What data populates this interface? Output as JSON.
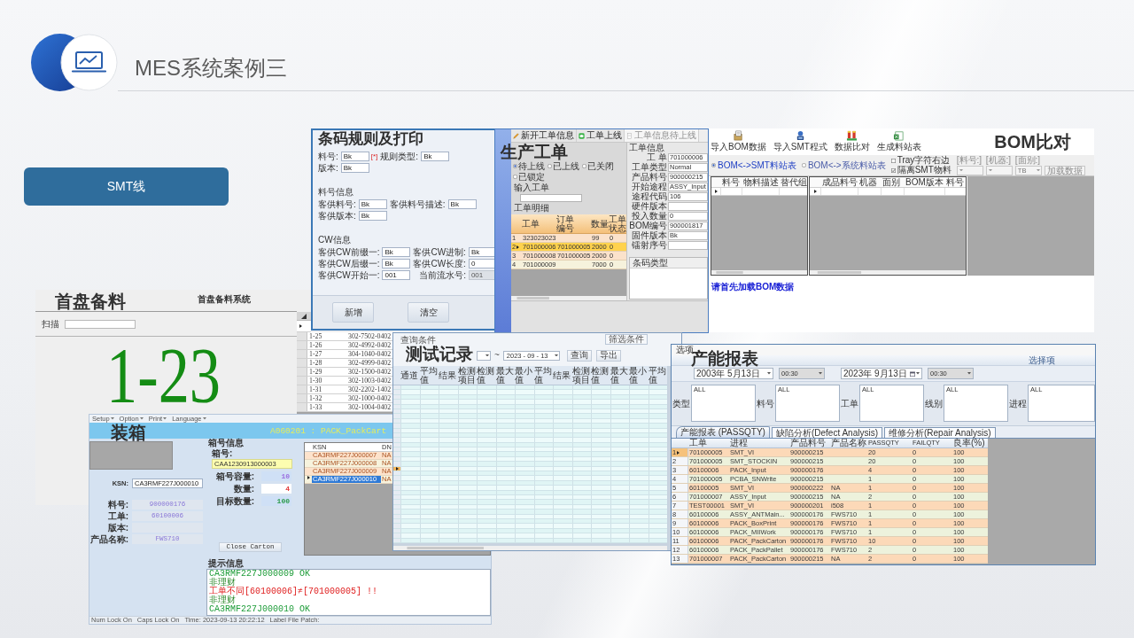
{
  "header": {
    "title": "MES系统案例三"
  },
  "line_button": {
    "label": "SMT线"
  },
  "screenshots": [
    {
      "kind": "first_reel",
      "title": "首盘备料",
      "subtitle": "首盘备料系统",
      "scan_label": "扫描",
      "current_slot": "1-23",
      "rows": [
        {
          "slot": "1-25",
          "part": "302-7502-0402"
        },
        {
          "slot": "1-26",
          "part": "302-4992-0402"
        },
        {
          "slot": "1-27",
          "part": "304-1040-0402"
        },
        {
          "slot": "1-28",
          "part": "302-4999-0402"
        },
        {
          "slot": "1-29",
          "part": "302-1500-0402"
        },
        {
          "slot": "1-30",
          "part": "302-1003-0402"
        },
        {
          "slot": "1-31",
          "part": "302-2202-1402"
        },
        {
          "slot": "1-32",
          "part": "302-1000-0402"
        },
        {
          "slot": "1-33",
          "part": "302-1004-0402"
        }
      ]
    },
    {
      "kind": "barcode_rules",
      "title": "条码规则及打印",
      "top_fields": [
        {
          "label": "料号:",
          "value": "Bk",
          "required_mark": "[*]",
          "disabled": false
        },
        {
          "label": "规则类型:",
          "value": "Bk",
          "disabled": false
        },
        {
          "label": "版本:",
          "value": "Bk",
          "disabled": false
        }
      ],
      "groups": [
        {
          "heading": "料号信息",
          "fields": [
            {
              "label": "客供料号:",
              "value": "Bk",
              "disabled": false
            },
            {
              "label": "客供料号描述:",
              "value": "Bk",
              "disabled": false
            },
            {
              "label": "客供版本:",
              "value": "Bk",
              "disabled": false
            }
          ]
        },
        {
          "heading": "CW信息",
          "fields": [
            {
              "label": "客供CW前缀一:",
              "value": "Bk",
              "disabled": false
            },
            {
              "label": "客供CW进制:",
              "value": "Bk",
              "disabled": false
            },
            {
              "label": "客供CW后缀一:",
              "value": "Bk",
              "disabled": false
            },
            {
              "label": "客供CW长度:",
              "value": "0",
              "disabled": false
            },
            {
              "label": "客供CW开始一:",
              "value": "001",
              "disabled": false
            },
            {
              "label": "当前流水号:",
              "value": "001",
              "disabled": true
            }
          ]
        }
      ],
      "buttons": [
        "新增",
        "清空"
      ]
    },
    {
      "kind": "work_order",
      "title": "生产工单",
      "toolbar": [
        {
          "label": "新开工单信息",
          "disabled": false
        },
        {
          "label": "工单上线",
          "disabled": false
        },
        {
          "label": "工单信息待上线",
          "disabled": true
        }
      ],
      "status_options": [
        {
          "label": "待上线",
          "selected": true
        },
        {
          "label": "已上线",
          "selected": false
        },
        {
          "label": "已关闭",
          "selected": false
        },
        {
          "label": "已锁定",
          "selected": false
        }
      ],
      "input_label": "输入工单",
      "table_label": "工单明细",
      "columns": [
        "工单",
        "订单编号",
        "数量",
        "工单状态"
      ],
      "rows": [
        {
          "index": "1",
          "cells": [
            "323023023",
            null,
            "99",
            "0"
          ],
          "selected": false
        },
        {
          "index": "2",
          "cells": [
            "701000006",
            "701000005",
            "2000",
            "0"
          ],
          "selected": true
        },
        {
          "index": "3",
          "cells": [
            "701000008",
            "701000005",
            "2000",
            "0"
          ],
          "selected": false
        },
        {
          "index": "4",
          "cells": [
            "701000009",
            null,
            "7000",
            "0"
          ],
          "selected": false
        }
      ],
      "info_heading": "工单信息",
      "info": [
        {
          "label": "工 单",
          "value": "701000006"
        },
        {
          "label": "工单类型",
          "value": "Normal"
        },
        {
          "label": "产品料号",
          "value": "900000215"
        },
        {
          "label": "开始途程",
          "value": "ASSY_Input"
        },
        {
          "label": "途程代码",
          "value": "106"
        },
        {
          "label": "硬件版本"
        },
        {
          "label": "投入数量",
          "value": "0"
        },
        {
          "label": "BOM编号",
          "value": "900001817"
        },
        {
          "label": "固件版本",
          "value": "Bk"
        },
        {
          "label": "镭射序号"
        }
      ],
      "barcode_columns": [
        "条码类型"
      ]
    },
    {
      "kind": "bom_compare",
      "title": "BOM比对",
      "tools": [
        "导入BOM数据",
        "导入SMT程式",
        "数据比对",
        "生成料站表"
      ],
      "modes": [
        {
          "label": "BOM<->SMT料站表",
          "selected": true
        },
        {
          "label": "BOM<->系统料站表",
          "selected": false
        }
      ],
      "options": [
        {
          "label": "Tray字符右边",
          "checked": false
        },
        {
          "label": "隔离SMT物料",
          "checked": true
        }
      ],
      "filters": [
        {
          "label": "[料号:]"
        },
        {
          "label": "[机器:]"
        },
        {
          "label": "[面别:]",
          "value": "TB"
        }
      ],
      "load_button": "加载数据",
      "part_columns": [
        "料号",
        "物料描述",
        "替代组"
      ],
      "program_columns": [
        "成品料号",
        "机器",
        "面别",
        "BOM版本",
        "料号"
      ],
      "message": "请首先加载BOM数据"
    },
    {
      "kind": "packing",
      "menu": [
        "Setup",
        "Option",
        "Print",
        "Language"
      ],
      "title": "装箱",
      "station": "A060201 : PACK_PackCart",
      "ksn_label": "KSN:",
      "ksn_value": "CA3RMF227J000010",
      "product": [
        {
          "label": "料号:",
          "value": "900000176"
        },
        {
          "label": "工单:",
          "value": "60100006"
        },
        {
          "label": "版本:"
        },
        {
          "label": "产品名称:",
          "value": "FWS710"
        }
      ],
      "carton_heading": "箱号信息",
      "carton_label": "箱号:",
      "carton_value": "CAA1230913000003",
      "counts": [
        {
          "label": "箱号容量:",
          "value": "10",
          "kind": "capacity"
        },
        {
          "label": "数量:",
          "value": "4",
          "kind": "count"
        },
        {
          "label": "目标数量:",
          "value": "100",
          "kind": "target"
        }
      ],
      "close_button": "Close Carton",
      "grid_columns": [
        "KSN",
        "DN"
      ],
      "grid_rows": [
        {
          "cells": [
            "CA3RMF227J000007",
            "NA"
          ],
          "selected": false
        },
        {
          "cells": [
            "CA3RMF227J000008",
            "NA"
          ],
          "selected": false
        },
        {
          "cells": [
            "CA3RMF227J000009",
            "NA"
          ],
          "selected": false
        },
        {
          "cells": [
            "CA3RMF227J000010",
            "NA"
          ],
          "selected": true
        }
      ],
      "message_heading": "提示信息",
      "messages": [
        {
          "text": "CA3RMF227J000009 OK",
          "kind": "ok"
        },
        {
          "text": "非理财",
          "kind": "note"
        },
        {
          "text": "工单不同[60100006]≠[701000005] !!",
          "kind": "error"
        },
        {
          "text": "非理财",
          "kind": "note"
        },
        {
          "text": "CA3RMF227J000010 OK",
          "kind": "ok"
        }
      ],
      "status_bar": [
        "Num Lock On",
        "Caps Lock On",
        "Time: 2023-09-13 20:22:12",
        "Label File Patch:"
      ]
    },
    {
      "kind": "test_records",
      "title": "测试记录",
      "query_label": "查询条件",
      "filter_button": "筛选条件",
      "range_separator": "~",
      "date_to": "2023 - 09 - 13",
      "buttons": [
        "查询",
        "导出"
      ],
      "columns": [
        "通道",
        "平均值",
        "结果",
        "检测项目",
        "检测值",
        "最大值",
        "最小值",
        "平均值",
        "结果",
        "检测项目",
        "检测值",
        "最大值",
        "最小值",
        "平均值"
      ],
      "rows": [
        {
          "selected": false
        },
        {
          "selected": false
        },
        {
          "selected": false
        },
        {
          "selected": false
        },
        {
          "selected": false
        },
        {
          "selected": false
        },
        {
          "selected": false
        },
        {
          "selected": false
        },
        {
          "selected": false
        },
        {
          "selected": false
        },
        {
          "selected": false
        },
        {
          "selected": false
        },
        {
          "selected": false
        },
        {
          "selected": false
        },
        {
          "selected": false
        },
        {
          "selected": false
        },
        {
          "selected": false
        },
        {
          "selected": true
        },
        {
          "selected": false
        },
        {
          "selected": false
        },
        {
          "selected": false
        },
        {
          "selected": false
        },
        {
          "selected": false
        },
        {
          "selected": false
        },
        {
          "selected": false
        },
        {
          "selected": false
        },
        {
          "selected": false
        },
        {
          "selected": false
        },
        {
          "selected": false
        },
        {
          "selected": false
        },
        {
          "selected": false
        },
        {
          "selected": false
        },
        {
          "selected": false
        }
      ]
    },
    {
      "kind": "capacity_report",
      "menu": "选项",
      "title": "产能报表",
      "options_label": "选择项",
      "start_date": "2003年 5月13日",
      "start_time": "00:30",
      "end_date": "2023年 9月13日",
      "end_time": "00:30",
      "filters": [
        {
          "label": "类型",
          "value": "ALL"
        },
        {
          "label": "料号",
          "value": "ALL"
        },
        {
          "label": "工单",
          "value": "ALL"
        },
        {
          "label": "线别",
          "value": "ALL"
        },
        {
          "label": "进程",
          "value": "ALL"
        }
      ],
      "tabs": [
        {
          "label": "产能报表 (PASSQTY)",
          "selected": true
        },
        {
          "label": "缺陷分析(Defect Analysis)",
          "selected": false
        },
        {
          "label": "维修分析(Repair Analysis)",
          "selected": false
        }
      ],
      "columns": [
        "工单",
        "进程",
        "产品料号",
        "产品名称",
        "PASSQTY",
        "FAILQTY",
        "良率(%)"
      ],
      "rows": [
        {
          "index": "1",
          "cells": [
            "701000005",
            "SMT_VI",
            "900000215",
            null,
            "20",
            "0",
            "100"
          ],
          "selected": true
        },
        {
          "index": "2",
          "cells": [
            "701000005",
            "SMT_STOCKIN",
            "900000215",
            null,
            "20",
            "0",
            "100"
          ],
          "selected": false
        },
        {
          "index": "3",
          "cells": [
            "60100006",
            "PACK_Input",
            "900000176",
            null,
            "4",
            "0",
            "100"
          ],
          "selected": false
        },
        {
          "index": "4",
          "cells": [
            "701000005",
            "PCBA_SNWrite",
            "900000215",
            null,
            "1",
            "0",
            "100"
          ],
          "selected": false
        },
        {
          "index": "5",
          "cells": [
            "60100005",
            "SMT_VI",
            "900000222",
            "NA",
            "1",
            "0",
            "100"
          ],
          "selected": false
        },
        {
          "index": "6",
          "cells": [
            "701000007",
            "ASSY_Input",
            "900000215",
            "NA",
            "2",
            "0",
            "100"
          ],
          "selected": false
        },
        {
          "index": "7",
          "cells": [
            "TEST00001",
            "SMT_VI",
            "900000201",
            "i508",
            "1",
            "0",
            "100"
          ],
          "selected": false
        },
        {
          "index": "8",
          "cells": [
            "60100006",
            "ASSY_ANTMain...",
            "900000176",
            "FWS710",
            "1",
            "0",
            "100"
          ],
          "selected": false
        },
        {
          "index": "9",
          "cells": [
            "60100006",
            "PACK_BoxPrint",
            "900000176",
            "FWS710",
            "1",
            "0",
            "100"
          ],
          "selected": false
        },
        {
          "index": "10",
          "cells": [
            "60100006",
            "PACK_MIIWork",
            "900000176",
            "FWS710",
            "1",
            "0",
            "100"
          ],
          "selected": false
        },
        {
          "index": "11",
          "cells": [
            "60100006",
            "PACK_PackCarton",
            "900000176",
            "FWS710",
            "10",
            "0",
            "100"
          ],
          "selected": false
        },
        {
          "index": "12",
          "cells": [
            "60100006",
            "PACK_PackPallet",
            "900000176",
            "FWS710",
            "2",
            "0",
            "100"
          ],
          "selected": false
        },
        {
          "index": "13",
          "cells": [
            "701000007",
            "PACK_PackCarton",
            "900000215",
            "NA",
            "2",
            "0",
            "100"
          ],
          "selected": false
        }
      ]
    }
  ]
}
